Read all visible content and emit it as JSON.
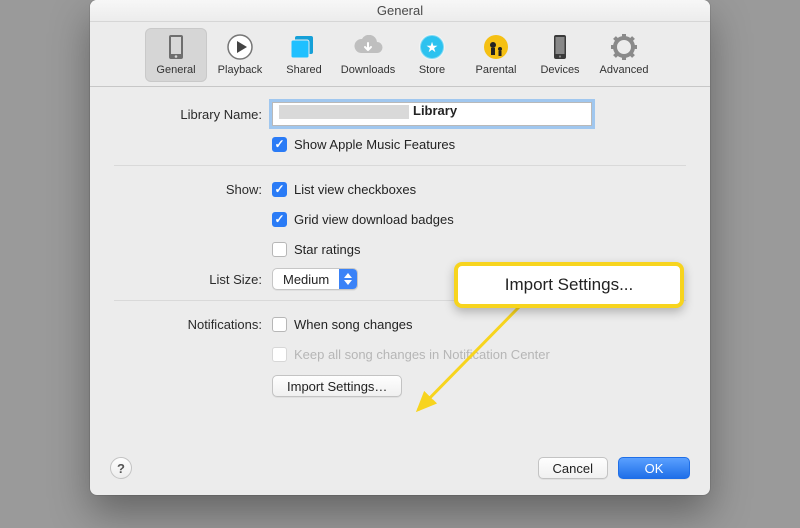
{
  "window": {
    "title": "General"
  },
  "tabs": [
    {
      "label": "General"
    },
    {
      "label": "Playback"
    },
    {
      "label": "Shared"
    },
    {
      "label": "Downloads"
    },
    {
      "label": "Store"
    },
    {
      "label": "Parental"
    },
    {
      "label": "Devices"
    },
    {
      "label": "Advanced"
    }
  ],
  "library": {
    "name_label": "Library Name:",
    "value_suffix": "Library",
    "apple_music": "Show Apple Music Features"
  },
  "show": {
    "label": "Show:",
    "list_checkboxes": "List view checkboxes",
    "grid_badges": "Grid view download badges",
    "star_ratings": "Star ratings",
    "list_size_label": "List Size:",
    "list_size_value": "Medium"
  },
  "notifications": {
    "label": "Notifications:",
    "song_changes": "When song changes",
    "nc": "Keep all song changes in Notification Center",
    "import": "Import Settings…"
  },
  "callout": {
    "text": "Import Settings..."
  },
  "footer": {
    "cancel": "Cancel",
    "ok": "OK",
    "help": "?"
  }
}
